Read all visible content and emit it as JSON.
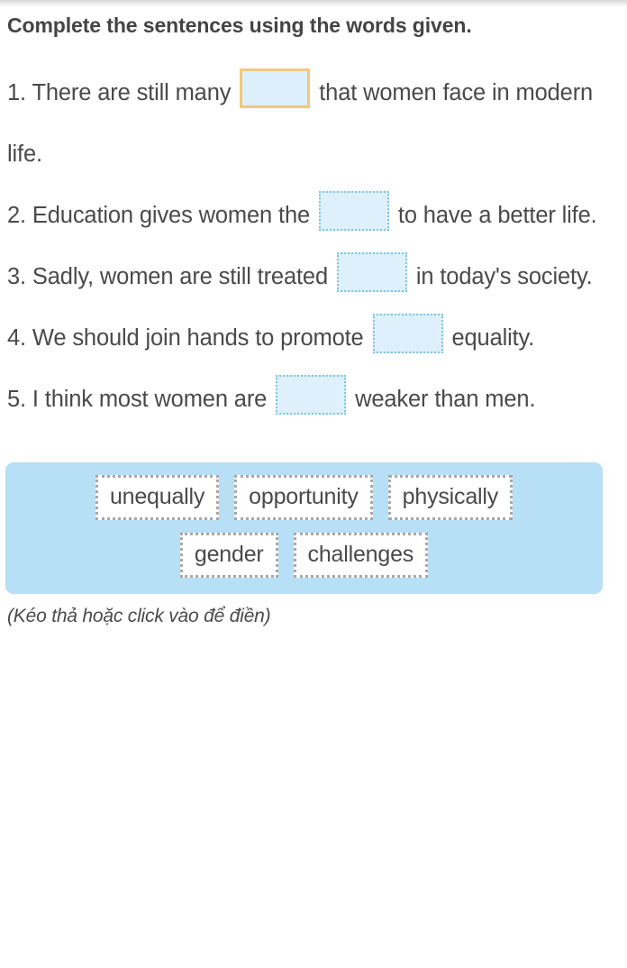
{
  "exercise": {
    "title": "Complete the sentences using the words given.",
    "hint": "(Kéo thả hoặc click vào để điền)",
    "sentences": [
      {
        "number": "1.",
        "before": "1. There are still many",
        "after": "that women face in modern life.",
        "blank_state": "active",
        "blank_value": ""
      },
      {
        "number": "2.",
        "before": "2. Education gives women the",
        "after": "to have a better life.",
        "blank_state": "empty",
        "blank_value": ""
      },
      {
        "number": "3.",
        "before": "3. Sadly, women are still treated",
        "after": "in today's society.",
        "blank_state": "empty",
        "blank_value": ""
      },
      {
        "number": "4.",
        "before": "4. We should join hands to promote",
        "after": "equality.",
        "blank_state": "empty",
        "blank_value": ""
      },
      {
        "number": "5.",
        "before": "5. I think most women are",
        "after": "weaker than men.",
        "blank_state": "empty",
        "blank_value": ""
      }
    ],
    "word_bank": {
      "rows": [
        [
          "unequally",
          "opportunity",
          "physically"
        ],
        [
          "gender",
          "challenges"
        ]
      ]
    },
    "colors": {
      "word_bank_bg": "#b7dff5",
      "blank_fill": "#ddf0fb",
      "blank_border": "#7cc4e8",
      "blank_active_border": "#f3c87c",
      "chip_border": "#a8a8a8",
      "text": "#4a4a4a",
      "title": "#444444"
    }
  }
}
